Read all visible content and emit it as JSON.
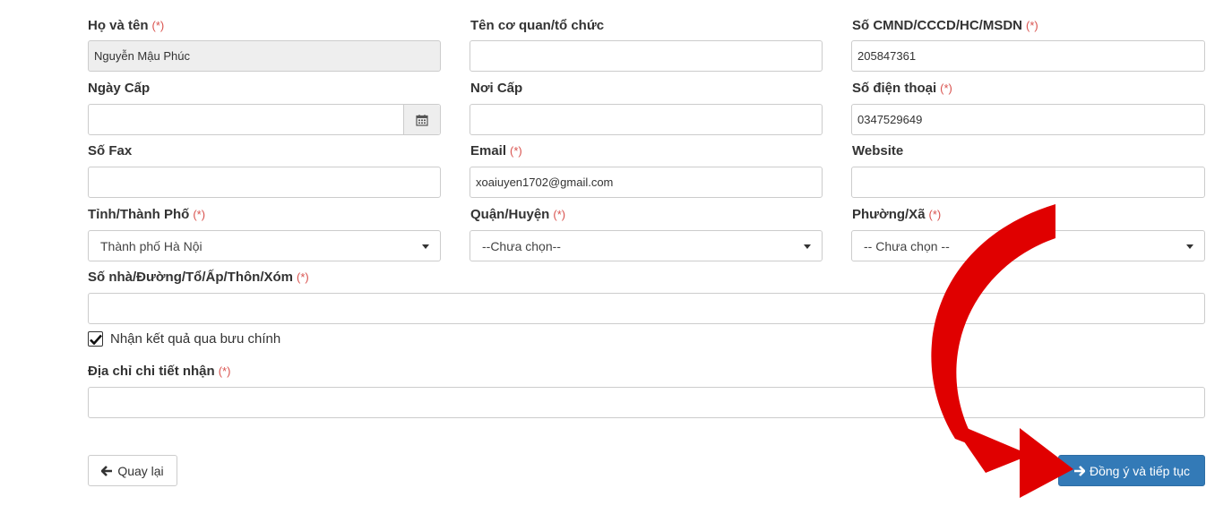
{
  "required_mark": "(*)",
  "fields": {
    "full_name": {
      "label": "Họ và tên",
      "value": "Nguyễn Mậu Phúc",
      "required": true
    },
    "organization": {
      "label": "Tên cơ quan/tổ chức",
      "value": ""
    },
    "id_number": {
      "label": "Số CMND/CCCD/HC/MSDN",
      "value": "205847361",
      "required": true
    },
    "issue_date": {
      "label": "Ngày Cấp",
      "value": ""
    },
    "issue_place": {
      "label": "Nơi Cấp",
      "value": ""
    },
    "phone": {
      "label": "Số điện thoại",
      "value": "0347529649",
      "required": true
    },
    "fax": {
      "label": "Số Fax",
      "value": ""
    },
    "email": {
      "label": "Email",
      "value": "xoaiuyen1702@gmail.com",
      "required": true
    },
    "website": {
      "label": "Website",
      "value": ""
    },
    "province": {
      "label": "Tỉnh/Thành Phố",
      "selected": "Thành phố Hà Nội",
      "required": true
    },
    "district": {
      "label": "Quận/Huyện",
      "selected": "--Chưa chọn--",
      "required": true
    },
    "ward": {
      "label": "Phường/Xã",
      "selected": "-- Chưa chọn --",
      "required": true
    },
    "street": {
      "label": "Số nhà/Đường/Tổ/Ấp/Thôn/Xóm",
      "value": "",
      "required": true
    },
    "postal_checkbox": {
      "label": "Nhận kết quả qua bưu chính",
      "checked": true
    },
    "delivery_address": {
      "label": "Địa chỉ chi tiết nhận",
      "value": "",
      "required": true
    }
  },
  "buttons": {
    "back": "Quay lại",
    "next": "Đồng ý và tiếp tục"
  },
  "icons": {
    "calendar": "calendar-icon",
    "back": "arrow-left-icon",
    "next": "arrow-right-icon",
    "caret": "caret-down-icon",
    "annotation": "curved-arrow-icon"
  },
  "colors": {
    "required": "#d9534f",
    "primary_button": "#337ab7",
    "annotation_arrow": "#e00000"
  }
}
